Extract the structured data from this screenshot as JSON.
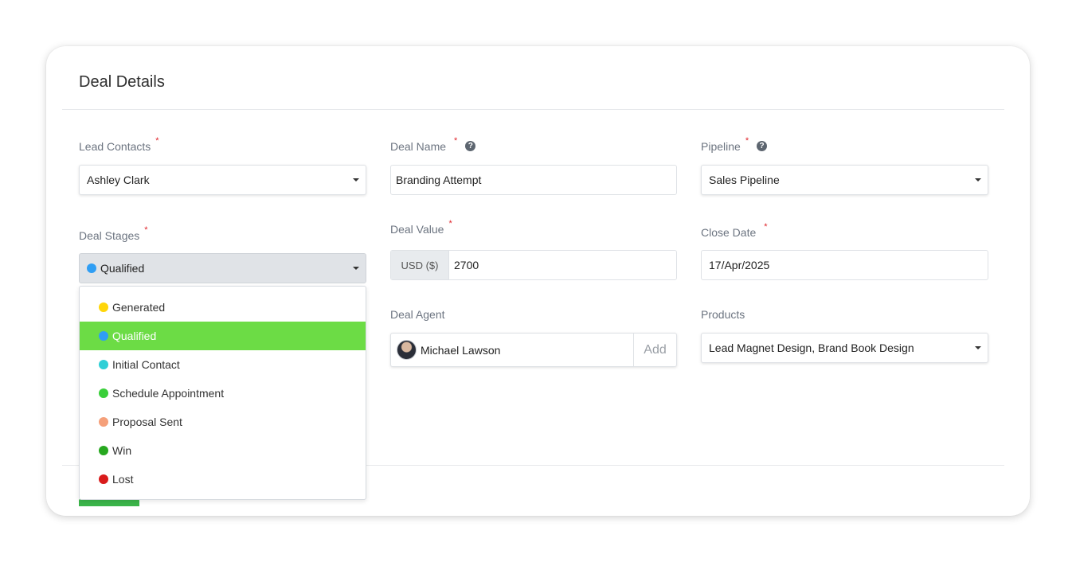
{
  "title": "Deal Details",
  "fields": {
    "lead_contacts": {
      "label": "Lead Contacts",
      "required": "*",
      "value": "Ashley Clark"
    },
    "deal_name": {
      "label": "Deal Name",
      "required": "*",
      "help": "?",
      "value": "Branding Attempt"
    },
    "pipeline": {
      "label": "Pipeline",
      "required": "*",
      "help": "?",
      "value": "Sales Pipeline"
    },
    "deal_stages": {
      "label": "Deal Stages",
      "required": "*",
      "value": "Qualified",
      "value_color": "#2f9ef4"
    },
    "deal_value": {
      "label": "Deal Value",
      "required": "*",
      "currency": "USD ($)",
      "value": "2700"
    },
    "close_date": {
      "label": "Close Date",
      "required": "*",
      "value": "17/Apr/2025"
    },
    "deal_agent": {
      "label": "Deal Agent",
      "value": "Michael Lawson",
      "add_label": "Add"
    },
    "products": {
      "label": "Products",
      "value": "Lead Magnet Design, Brand Book Design"
    }
  },
  "stage_options": [
    {
      "label": "Generated",
      "color": "#ffd60a"
    },
    {
      "label": "Qualified",
      "color": "#2f9ef4",
      "selected": true
    },
    {
      "label": "Initial Contact",
      "color": "#2fcfd6"
    },
    {
      "label": "Schedule Appointment",
      "color": "#3acf3a"
    },
    {
      "label": "Proposal Sent",
      "color": "#f5a07a"
    },
    {
      "label": "Win",
      "color": "#27a81f"
    },
    {
      "label": "Lost",
      "color": "#d91b1b"
    }
  ],
  "colors": {
    "accent_green": "#6cdc45",
    "required": "#e0252b"
  }
}
